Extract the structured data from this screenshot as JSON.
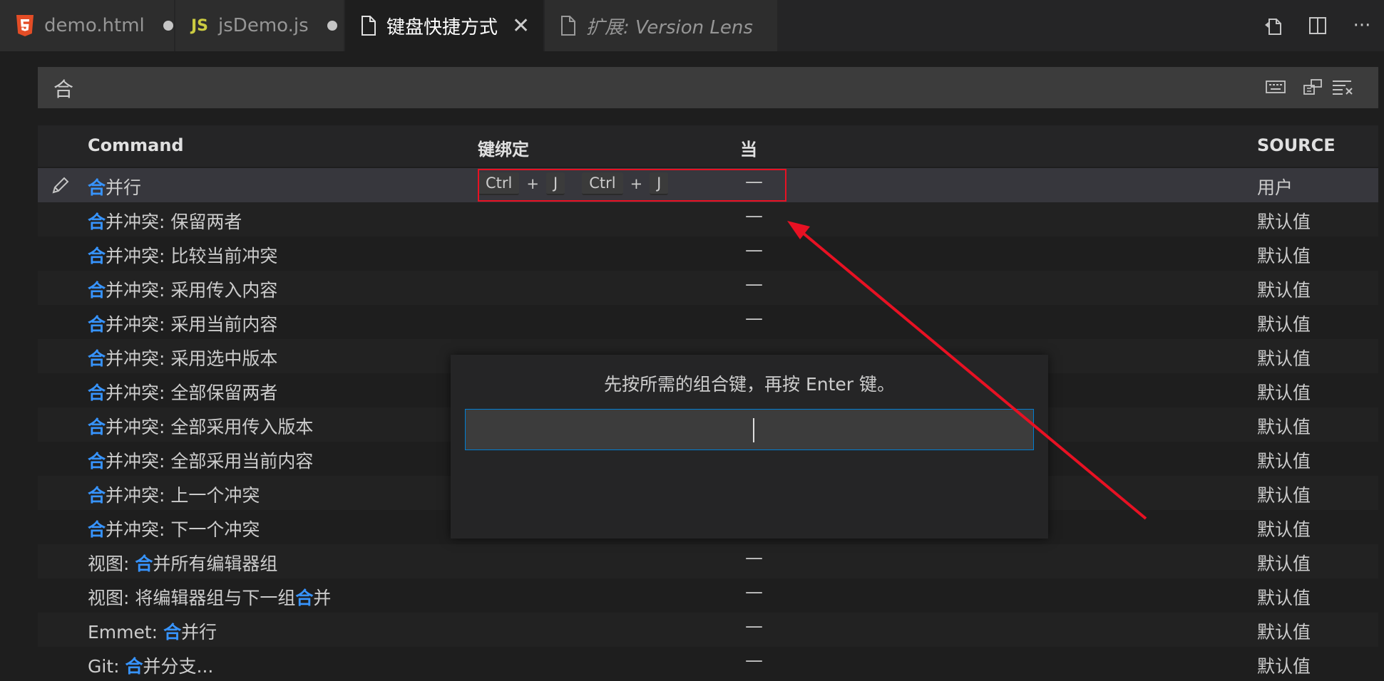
{
  "tabs": [
    {
      "label": "demo.html",
      "icon": "html5-icon",
      "dirty": true
    },
    {
      "label": "jsDemo.js",
      "icon_text": "JS",
      "dirty": true
    },
    {
      "label": "键盘快捷方式",
      "icon": "file-icon",
      "active": true
    },
    {
      "label": "扩展: Version Lens",
      "icon": "file-icon",
      "preview": true
    }
  ],
  "search": {
    "query": "合"
  },
  "table": {
    "headers": {
      "command": "Command",
      "keybinding": "键绑定",
      "when": "当",
      "source": "SOURCE"
    },
    "rows": [
      {
        "hl": "合",
        "rest": "并行",
        "when": "—",
        "source": "用户",
        "keys": [
          "Ctrl",
          "+",
          "J",
          "Ctrl",
          "+",
          "J"
        ]
      },
      {
        "hl": "合",
        "rest": "并冲突: 保留两者",
        "when": "—",
        "source": "默认值"
      },
      {
        "hl": "合",
        "rest": "并冲突: 比较当前冲突",
        "when": "—",
        "source": "默认值"
      },
      {
        "hl": "合",
        "rest": "并冲突: 采用传入内容",
        "when": "—",
        "source": "默认值"
      },
      {
        "hl": "合",
        "rest": "并冲突: 采用当前内容",
        "when": "—",
        "source": "默认值"
      },
      {
        "hl": "合",
        "rest": "并冲突: 采用选中版本",
        "when": "",
        "source": "默认值"
      },
      {
        "hl": "合",
        "rest": "并冲突: 全部保留两者",
        "when": "",
        "source": "默认值"
      },
      {
        "hl": "合",
        "rest": "并冲突: 全部采用传入版本",
        "when": "",
        "source": "默认值"
      },
      {
        "hl": "合",
        "rest": "并冲突: 全部采用当前内容",
        "when": "",
        "source": "默认值"
      },
      {
        "hl": "合",
        "rest": "并冲突: 上一个冲突",
        "when": "",
        "source": "默认值"
      },
      {
        "hl": "合",
        "rest": "并冲突: 下一个冲突",
        "when": "",
        "source": "默认值"
      },
      {
        "pre": "视图: ",
        "hl": "合",
        "rest": "并所有编辑器组",
        "when": "—",
        "source": "默认值"
      },
      {
        "pre": "视图: 将编辑器组与下一组",
        "hl": "合",
        "rest": "并",
        "when": "—",
        "source": "默认值"
      },
      {
        "pre": "Emmet: ",
        "hl": "合",
        "rest": "并行",
        "when": "—",
        "source": "默认值"
      },
      {
        "pre": "Git: ",
        "hl": "合",
        "rest": "并分支...",
        "when": "—",
        "source": "默认值"
      }
    ]
  },
  "dialog": {
    "message": "先按所需的组合键，再按 Enter 键。"
  },
  "colors": {
    "accent": "#3794ff",
    "annotation": "#e81123",
    "focus_border": "#007fd4"
  }
}
